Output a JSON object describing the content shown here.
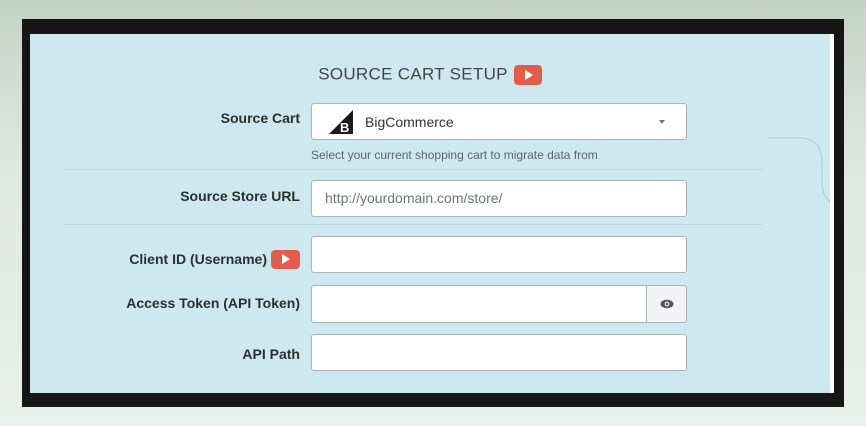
{
  "title": "SOURCE CART SETUP",
  "title_icon": "youtube-play-icon",
  "fields": {
    "source_cart": {
      "label": "Source Cart",
      "value": "BigCommerce",
      "logo_icon": "bigcommerce-logo-icon",
      "helper": "Select your current shopping cart to migrate data from"
    },
    "store_url": {
      "label": "Source Store URL",
      "placeholder": "http://yourdomain.com/store/",
      "value": ""
    },
    "client_id": {
      "label": "Client ID (Username)",
      "icon": "youtube-play-icon",
      "value": ""
    },
    "access_token": {
      "label": "Access Token (API Token)",
      "value": "",
      "toggle_icon": "eye-icon"
    },
    "api_path": {
      "label": "API Path",
      "value": ""
    }
  },
  "colors": {
    "panel_bg": "#cde9ef",
    "youtube_red": "#e25c4c",
    "frame": "#161616"
  }
}
